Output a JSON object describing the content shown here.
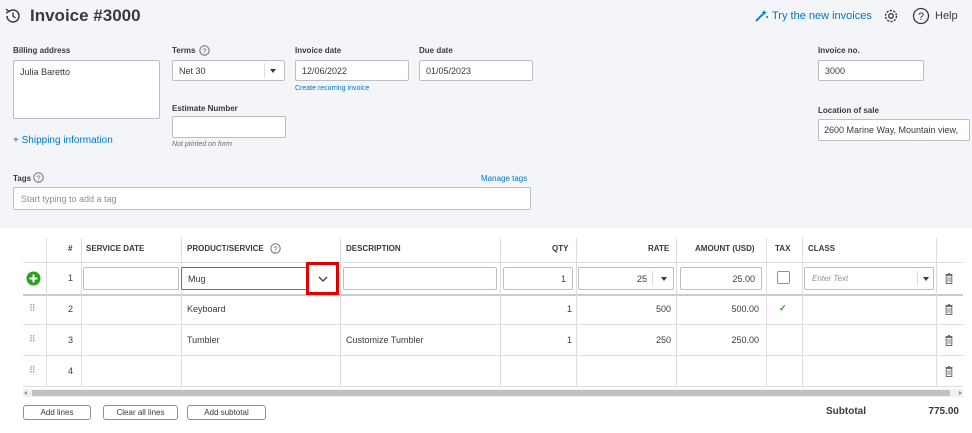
{
  "header": {
    "title": "Invoice #3000",
    "try_new": "Try the new invoices",
    "help": "Help"
  },
  "form": {
    "billing_label": "Billing address",
    "billing_value": "Julia Baretto",
    "shipping_link": "+ Shipping information",
    "terms_label": "Terms",
    "terms_value": "Net 30",
    "invoice_date_label": "Invoice date",
    "invoice_date_value": "12/06/2022",
    "recurring_link": "Create recurring invoice",
    "due_date_label": "Due date",
    "due_date_value": "01/05/2023",
    "estimate_label": "Estimate Number",
    "estimate_note": "Not printed on form",
    "invoice_no_label": "Invoice no.",
    "invoice_no_value": "3000",
    "location_label": "Location of sale",
    "location_value": "2600 Marine Way, Mountain view,",
    "tags_label": "Tags",
    "manage_tags": "Manage tags",
    "tags_placeholder": "Start typing to add a tag"
  },
  "table": {
    "headers": {
      "num": "#",
      "service_date": "SERVICE DATE",
      "product": "PRODUCT/SERVICE",
      "description": "DESCRIPTION",
      "qty": "QTY",
      "rate": "RATE",
      "amount": "AMOUNT (USD)",
      "tax": "TAX",
      "class": "CLASS"
    },
    "active_row": {
      "num": "1",
      "product": "Mug",
      "qty": "1",
      "rate": "25",
      "amount": "25.00",
      "class_placeholder": "Enter Text"
    },
    "rows": [
      {
        "num": "2",
        "product": "Keyboard",
        "description": "",
        "qty": "1",
        "rate": "500",
        "amount": "500.00",
        "tax": "✓"
      },
      {
        "num": "3",
        "product": "Tumbler",
        "description": "Customize Tumbler",
        "qty": "1",
        "rate": "250",
        "amount": "250.00",
        "tax": ""
      },
      {
        "num": "4",
        "product": "",
        "description": "",
        "qty": "",
        "rate": "",
        "amount": "",
        "tax": ""
      }
    ]
  },
  "footer": {
    "add_lines": "Add lines",
    "clear_all": "Clear all lines",
    "add_subtotal": "Add subtotal",
    "subtotal_label": "Subtotal",
    "subtotal_value": "775.00"
  },
  "colors": {
    "accent": "#0077c5",
    "green": "#2ca01c",
    "highlight": "#e00000"
  }
}
